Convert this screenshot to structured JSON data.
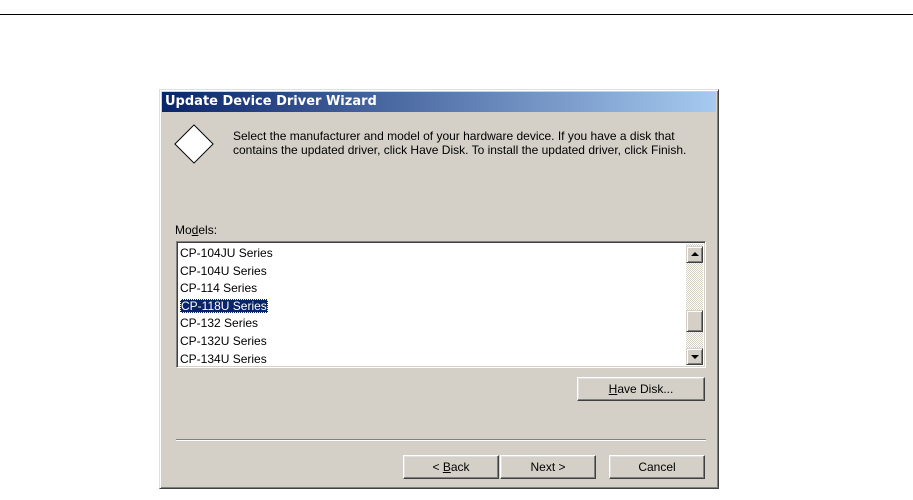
{
  "dialog": {
    "title": "Update Device Driver Wizard",
    "instructions": "Select the manufacturer and model of your hardware device. If you have a disk that contains the updated driver, click Have Disk. To install the updated driver, click Finish.",
    "models_label_pre": "Mo",
    "models_label_ul": "d",
    "models_label_post": "els:",
    "models": [
      "CP-104JU Series",
      "CP-104U Series",
      "CP-114 Series",
      "CP-118U Series",
      "CP-132 Series",
      "CP-132U Series",
      "CP-134U Series"
    ],
    "selected_model": "CP-118U Series",
    "have_disk": {
      "ul": "H",
      "rest": "ave Disk..."
    },
    "back": {
      "pre": "< ",
      "ul": "B",
      "rest": "ack"
    },
    "next_label": "Next >",
    "cancel_label": "Cancel"
  },
  "icons": {
    "wizard_icon": "diamond-icon",
    "scroll_up": "arrow-up-icon",
    "scroll_down": "arrow-down-icon"
  },
  "colors": {
    "titlebar_start": "#0a246a",
    "titlebar_end": "#a6caf0",
    "dialog_face": "#d4d0c8",
    "selection": "#0a246a"
  }
}
